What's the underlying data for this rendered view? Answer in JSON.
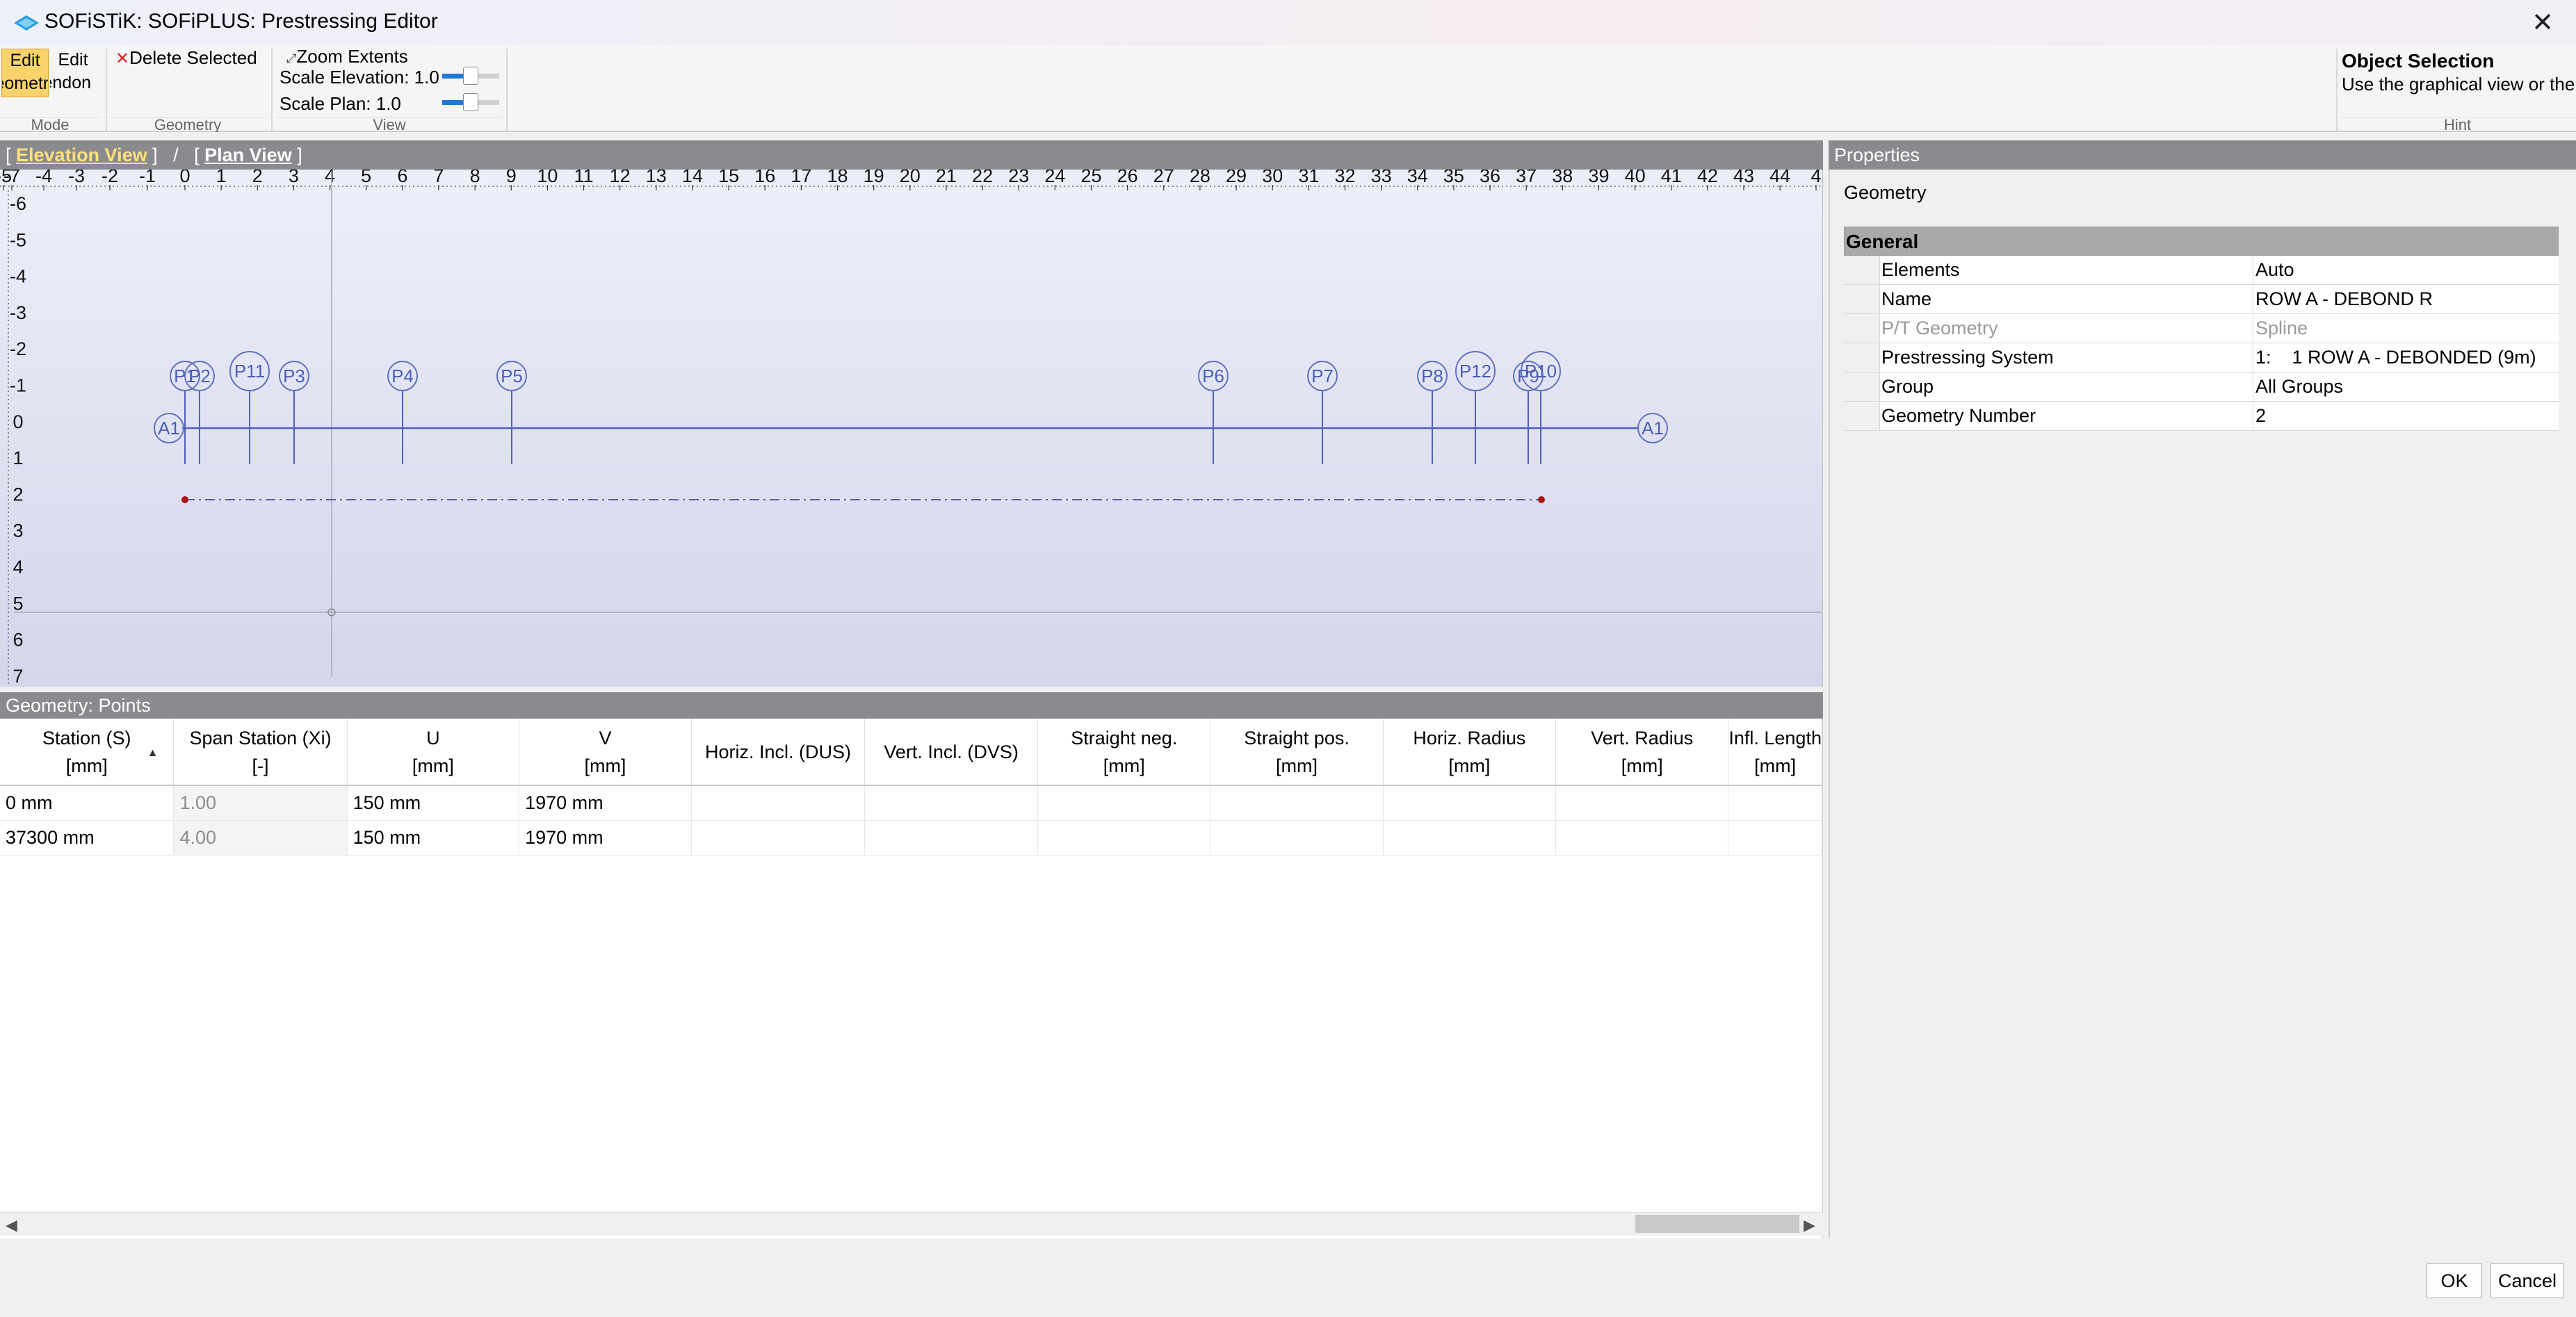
{
  "window": {
    "title": "SOFiSTiK: SOFiPLUS: Prestressing Editor",
    "close": "✕"
  },
  "ribbon": {
    "mode": {
      "edit_geometry": [
        "Edit",
        "Geometry"
      ],
      "edit_tendon": [
        "Edit",
        "Tendon"
      ],
      "footer": "Mode"
    },
    "geometry": {
      "delete_selected": "Delete Selected",
      "footer": "Geometry"
    },
    "view": {
      "zoom_extents": "Zoom Extents",
      "scale_elevation": "Scale Elevation: 1.0",
      "scale_plan": "Scale Plan: 1.0",
      "footer": "View"
    },
    "hint": {
      "title": "Object Selection",
      "text": "Use the graphical view or the",
      "footer": "Hint"
    }
  },
  "view": {
    "tab_elevation": "Elevation View",
    "tab_separator": "/",
    "tab_plan": "Plan View",
    "x_ticks": [
      "-5",
      "-7",
      "-4",
      "-3",
      "-2",
      "-1",
      "0",
      "1",
      "2",
      "3",
      "4",
      "5",
      "6",
      "7",
      "8",
      "9",
      "10",
      "11",
      "12",
      "13",
      "14",
      "15",
      "16",
      "17",
      "18",
      "19",
      "20",
      "21",
      "22",
      "23",
      "24",
      "25",
      "26",
      "27",
      "28",
      "29",
      "30",
      "31",
      "32",
      "33",
      "34",
      "35",
      "36",
      "37",
      "38",
      "39",
      "40",
      "41",
      "42",
      "43",
      "44",
      "4"
    ],
    "y_ticks": [
      "-6",
      "-5",
      "-4",
      "-3",
      "-2",
      "-1",
      "0",
      "1",
      "2",
      "3",
      "4",
      "5",
      "6",
      "7"
    ],
    "axis_labels": {
      "start": "A1",
      "end": "A1"
    },
    "points": [
      "P1",
      "P2",
      "P11",
      "P3",
      "P4",
      "P5",
      "P6",
      "P7",
      "P8",
      "P12",
      "P9",
      "P10"
    ]
  },
  "properties": {
    "header": "Properties",
    "section": "Geometry",
    "group": "General",
    "rows": [
      {
        "key": "Elements",
        "value": "Auto"
      },
      {
        "key": "Name",
        "value": "ROW A - DEBOND R"
      },
      {
        "key": "P/T Geometry",
        "value": "Spline"
      },
      {
        "key": "Prestressing System",
        "value": "1:    1 ROW A - DEBONDED (9m)"
      },
      {
        "key": "Group",
        "value": "All Groups"
      },
      {
        "key": "Geometry Number",
        "value": "2"
      }
    ]
  },
  "points_table": {
    "header": "Geometry: Points",
    "columns": [
      {
        "title": "Station (S)",
        "unit": "[mm]"
      },
      {
        "title": "Span Station (Xi)",
        "unit": "[-]"
      },
      {
        "title": "U",
        "unit": "[mm]"
      },
      {
        "title": "V",
        "unit": "[mm]"
      },
      {
        "title": "Horiz. Incl. (DUS)",
        "unit": ""
      },
      {
        "title": "Vert. Incl. (DVS)",
        "unit": ""
      },
      {
        "title": "Straight neg.",
        "unit": "[mm]"
      },
      {
        "title": "Straight pos.",
        "unit": "[mm]"
      },
      {
        "title": "Horiz. Radius",
        "unit": "[mm]"
      },
      {
        "title": "Vert. Radius",
        "unit": "[mm]"
      },
      {
        "title": "Infl. Length",
        "unit": "[mm]"
      }
    ],
    "rows": [
      [
        "0 mm",
        "1.00",
        "150 mm",
        "1970 mm",
        "",
        "",
        "",
        "",
        "",
        "",
        ""
      ],
      [
        "37300 mm",
        "4.00",
        "150 mm",
        "1970 mm",
        "",
        "",
        "",
        "",
        "",
        "",
        ""
      ]
    ]
  },
  "buttons": {
    "ok": "OK",
    "cancel": "Cancel"
  }
}
